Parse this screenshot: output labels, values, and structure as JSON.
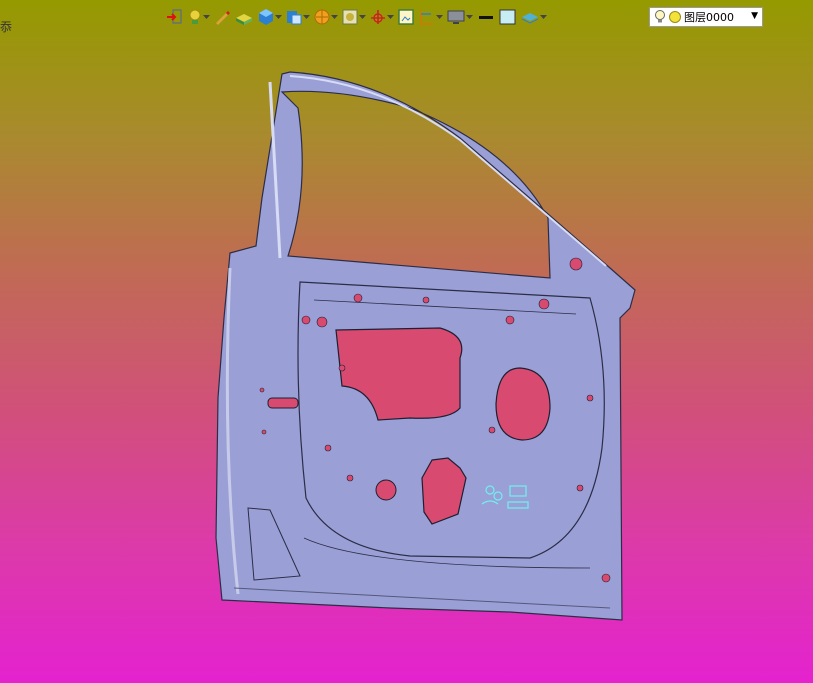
{
  "corner_glyph": "忝",
  "toolbar": {
    "buttons": [
      {
        "icon": "exit-red-arrow-icon",
        "has_menu": false
      },
      {
        "icon": "bulb-green-icon",
        "has_menu": true
      },
      {
        "icon": "pen-tool-icon",
        "has_menu": false
      },
      {
        "icon": "yellow-slab-icon",
        "has_menu": false
      },
      {
        "icon": "blue-cube-icon",
        "has_menu": true
      },
      {
        "icon": "blue-sheet-icon",
        "has_menu": true
      },
      {
        "icon": "orange-sphere-icon",
        "has_menu": true
      },
      {
        "icon": "render-box-icon",
        "has_menu": true
      },
      {
        "icon": "red-axis-icon",
        "has_menu": true
      },
      {
        "icon": "frame-icon",
        "has_menu": false
      },
      {
        "icon": "section-view-icon",
        "has_menu": true
      },
      {
        "icon": "monitor-icon",
        "has_menu": true
      },
      {
        "icon": "black-line-icon",
        "has_menu": false
      },
      {
        "icon": "color-swatch-icon",
        "has_menu": false
      },
      {
        "icon": "layer-plane-icon",
        "has_menu": true
      }
    ]
  },
  "layer": {
    "label": "图层0000",
    "icons": [
      "lightbulb-icon",
      "yellow-dot-icon"
    ]
  },
  "colors": {
    "background_top": "#959a00",
    "background_bottom": "#e422cf",
    "part": "#9aa0d6",
    "hole": "#d84a6f"
  }
}
